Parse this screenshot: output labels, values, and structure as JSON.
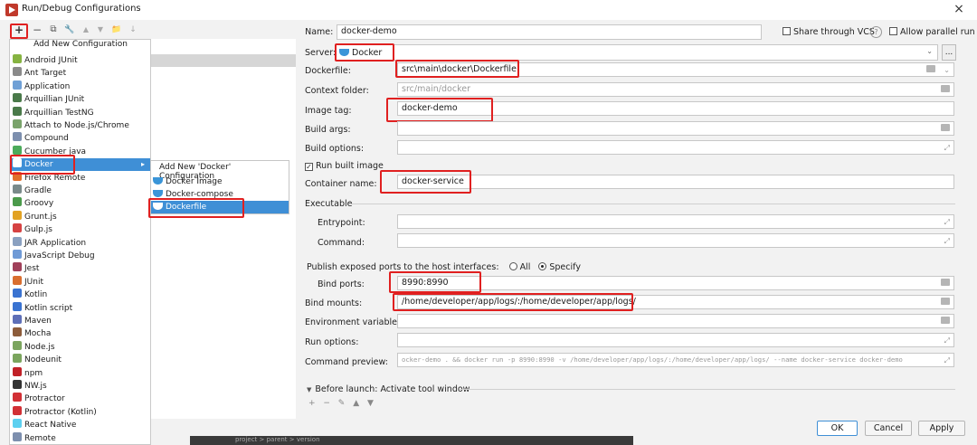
{
  "window": {
    "title": "Run/Debug Configurations",
    "close": "×"
  },
  "toolbar": {
    "add": "+",
    "remove": "−",
    "copy": "⧉",
    "edit": "🔧",
    "up": "▲",
    "down": "▼",
    "folder": "📁",
    "sort": "↓"
  },
  "add_menu": {
    "header": "Add New Configuration",
    "items": [
      {
        "label": "Android JUnit",
        "color": "#86b341"
      },
      {
        "label": "Ant Target",
        "color": "#8a8a8a"
      },
      {
        "label": "Application",
        "color": "#6fa0d6"
      },
      {
        "label": "Arquillian JUnit",
        "color": "#4a7a4a"
      },
      {
        "label": "Arquillian TestNG",
        "color": "#4a7a4a"
      },
      {
        "label": "Attach to Node.js/Chrome",
        "color": "#7aa36b"
      },
      {
        "label": "Compound",
        "color": "#7d8fae"
      },
      {
        "label": "Cucumber java",
        "color": "#4cab5b"
      },
      {
        "label": "Docker",
        "color": "#3a95d8"
      },
      {
        "label": "Firefox Remote",
        "color": "#e2702a"
      },
      {
        "label": "Gradle",
        "color": "#7a8a8a"
      },
      {
        "label": "Groovy",
        "color": "#4b9a4b"
      },
      {
        "label": "Grunt.js",
        "color": "#e2a223"
      },
      {
        "label": "Gulp.js",
        "color": "#d64242"
      },
      {
        "label": "JAR Application",
        "color": "#8aa0c0"
      },
      {
        "label": "JavaScript Debug",
        "color": "#6f9ad6"
      },
      {
        "label": "Jest",
        "color": "#a0405a"
      },
      {
        "label": "JUnit",
        "color": "#d96e2f"
      },
      {
        "label": "Kotlin",
        "color": "#3a73d1"
      },
      {
        "label": "Kotlin script",
        "color": "#3a73d1"
      },
      {
        "label": "Maven",
        "color": "#5e6fb7"
      },
      {
        "label": "Mocha",
        "color": "#8d5c3a"
      },
      {
        "label": "Node.js",
        "color": "#7ba55e"
      },
      {
        "label": "Nodeunit",
        "color": "#7ba55e"
      },
      {
        "label": "npm",
        "color": "#c12127"
      },
      {
        "label": "NW.js",
        "color": "#333333"
      },
      {
        "label": "Protractor",
        "color": "#d23035"
      },
      {
        "label": "Protractor (Kotlin)",
        "color": "#d23035"
      },
      {
        "label": "React Native",
        "color": "#5dd0f0"
      },
      {
        "label": "Remote",
        "color": "#7d8fae"
      }
    ],
    "selected_index": 8,
    "submenu_arrow": "▸"
  },
  "docker_submenu": {
    "header": "Add New 'Docker' Configuration",
    "items": [
      "Docker Image",
      "Docker-compose",
      "Dockerfile"
    ],
    "selected_index": 2
  },
  "form": {
    "name_label": "Name:",
    "name_value": "docker-demo",
    "share_vcs": "Share through VCS",
    "help": "?",
    "allow_parallel": "Allow parallel run",
    "server_label": "Server:",
    "server_value": "Docker",
    "more": "...",
    "dockerfile_label": "Dockerfile:",
    "dockerfile_value": "src\\main\\docker\\Dockerfile",
    "context_label": "Context folder:",
    "context_value": "src/main/docker",
    "image_tag_label": "Image tag:",
    "image_tag_value": "docker-demo",
    "build_args_label": "Build args:",
    "build_options_label": "Build options:",
    "run_built_image": "Run built image",
    "container_label": "Container name:",
    "container_value": "docker-service",
    "executable_label": "Executable",
    "entrypoint_label": "Entrypoint:",
    "command_label": "Command:",
    "publish_label": "Publish exposed ports to the host interfaces:",
    "radio_all": "All",
    "radio_specify": "Specify",
    "bind_ports_label": "Bind ports:",
    "bind_ports_value": "8990:8990",
    "bind_mounts_label": "Bind mounts:",
    "bind_mounts_value": "/home/developer/app/logs/:/home/developer/app/logs/",
    "env_label": "Environment variables:",
    "run_options_label": "Run options:",
    "preview_label": "Command preview:",
    "preview_value": "ocker-demo . && docker run -p 8990:8990 -v /home/developer/app/logs/:/home/developer/app/logs/ --name docker-service docker-demo",
    "before_launch": "Before launch: Activate tool window",
    "before_launch_toolbar": "+ − ✎ ▲ ▼"
  },
  "buttons": {
    "ok": "OK",
    "cancel": "Cancel",
    "apply": "Apply"
  },
  "statusbar": {
    "text": "project  >  parent  >  version"
  }
}
